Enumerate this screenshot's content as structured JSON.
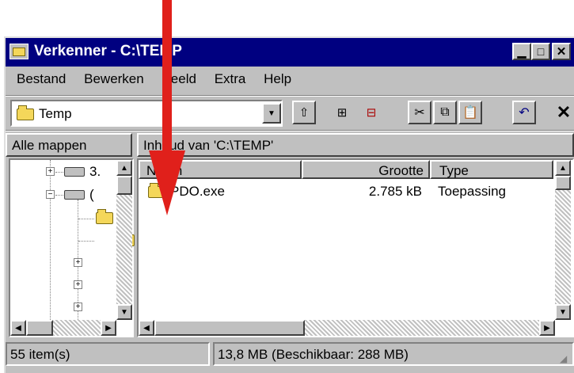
{
  "window": {
    "title": "Verkenner - C:\\TEMP"
  },
  "menu": [
    "Bestand",
    "Bewerken",
    "Beeld",
    "Extra",
    "Help"
  ],
  "toolbar": {
    "address_value": "Temp"
  },
  "panes": {
    "left_header": "Alle mappen",
    "right_header": "Inhoud van 'C:\\TEMP'"
  },
  "tree": {
    "item1_label": "3.",
    "item2_label": "("
  },
  "columns": {
    "name": "Naam",
    "size": "Grootte",
    "type": "Type"
  },
  "files": [
    {
      "name": "PDO.exe",
      "size": "2.785 kB",
      "type": "Toepassing"
    }
  ],
  "status": {
    "count": "55 item(s)",
    "size": "13,8 MB (Beschikbaar: 288 MB)"
  },
  "colors": {
    "title_bar": "#000080",
    "face": "#c0c0c0",
    "arrow": "#e0201b"
  }
}
